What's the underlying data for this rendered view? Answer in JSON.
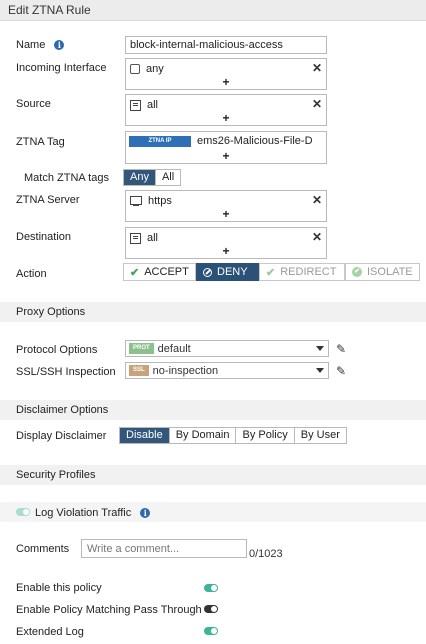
{
  "title": "Edit ZTNA Rule",
  "name": {
    "label": "Name",
    "value": "block-internal-malicious-access"
  },
  "incoming_interface": {
    "label": "Incoming Interface",
    "entry": "any",
    "icon": "interface-icon"
  },
  "source": {
    "label": "Source",
    "entry": "all",
    "icon": "address-icon"
  },
  "ztna_tag": {
    "label": "ZTNA Tag",
    "chip": "ZTNA IP",
    "entry": "ems26-Malicious-File-D"
  },
  "match_ztna_tags": {
    "label": "Match ZTNA tags",
    "options": [
      "Any",
      "All"
    ],
    "selected": "Any"
  },
  "ztna_server": {
    "label": "ZTNA Server",
    "entry": "https",
    "icon": "server-icon"
  },
  "destination": {
    "label": "Destination",
    "entry": "all",
    "icon": "address-icon"
  },
  "action": {
    "label": "Action",
    "options": [
      "ACCEPT",
      "DENY",
      "REDIRECT",
      "ISOLATE"
    ],
    "selected": "DENY"
  },
  "proxy_options": {
    "header": "Proxy Options",
    "protocol_options": {
      "label": "Protocol Options",
      "badge": "PROT",
      "value": "default"
    },
    "ssl_inspection": {
      "label": "SSL/SSH Inspection",
      "badge": "SSL",
      "value": "no-inspection"
    }
  },
  "disclaimer_options": {
    "header": "Disclaimer Options",
    "label": "Display Disclaimer",
    "options": [
      "Disable",
      "By Domain",
      "By Policy",
      "By User"
    ],
    "selected": "Disable"
  },
  "security_profiles": {
    "header": "Security Profiles"
  },
  "log_violation": {
    "label": "Log Violation Traffic",
    "enabled": true
  },
  "comments": {
    "label": "Comments",
    "placeholder": "Write a comment...",
    "counter": "0/1023"
  },
  "toggles": [
    {
      "label": "Enable this policy",
      "enabled": true
    },
    {
      "label": "Enable Policy Matching Pass Through",
      "enabled": false
    },
    {
      "label": "Extended Log",
      "enabled": true
    }
  ],
  "colors": {
    "accent": "#33567d",
    "deny": "#2b5179",
    "toggle_on": "#3cb49a",
    "accept_check": "#3aa655"
  }
}
